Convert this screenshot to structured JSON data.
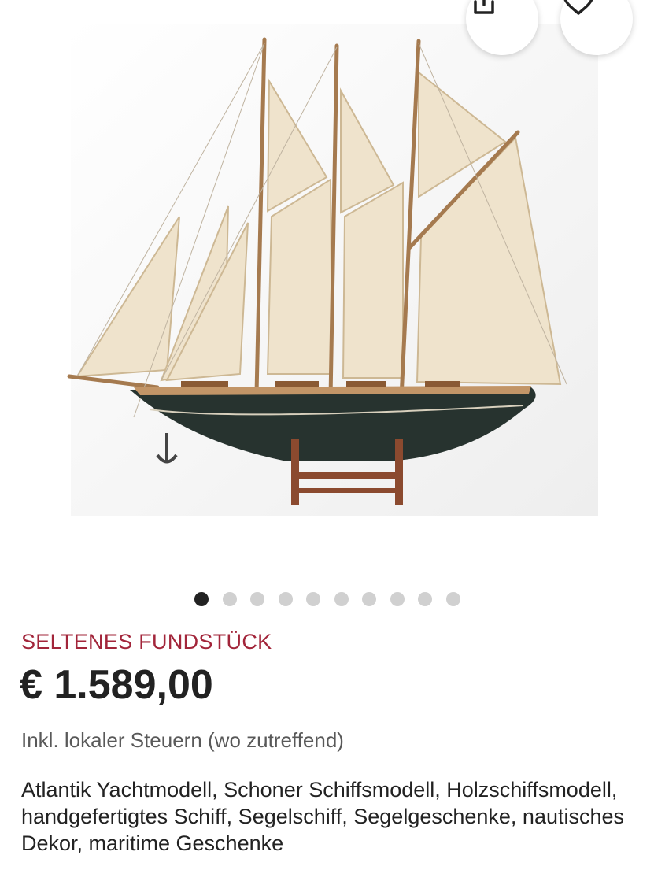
{
  "product": {
    "image_alt": "Schoner Schiffsmodell mit drei Masten",
    "carousel_total": 10,
    "carousel_active": 1,
    "tag": "SELTENES FUNDSTÜCK",
    "price": "€ 1.589,00",
    "tax_note": "Inkl. lokaler Steuern (wo zutreffend)",
    "title": "Atlantik Yachtmodell, Schoner Schiffsmodell, Holzschiffsmodell, handgefertigtes Schiff, Segelschiff, Segelgeschenke, nautisches Dekor, maritime Geschenke"
  },
  "icons": {
    "share": "share-icon",
    "favorite": "heart-icon"
  },
  "colors": {
    "accent": "#a2253a",
    "text": "#222222",
    "muted": "#595959"
  }
}
